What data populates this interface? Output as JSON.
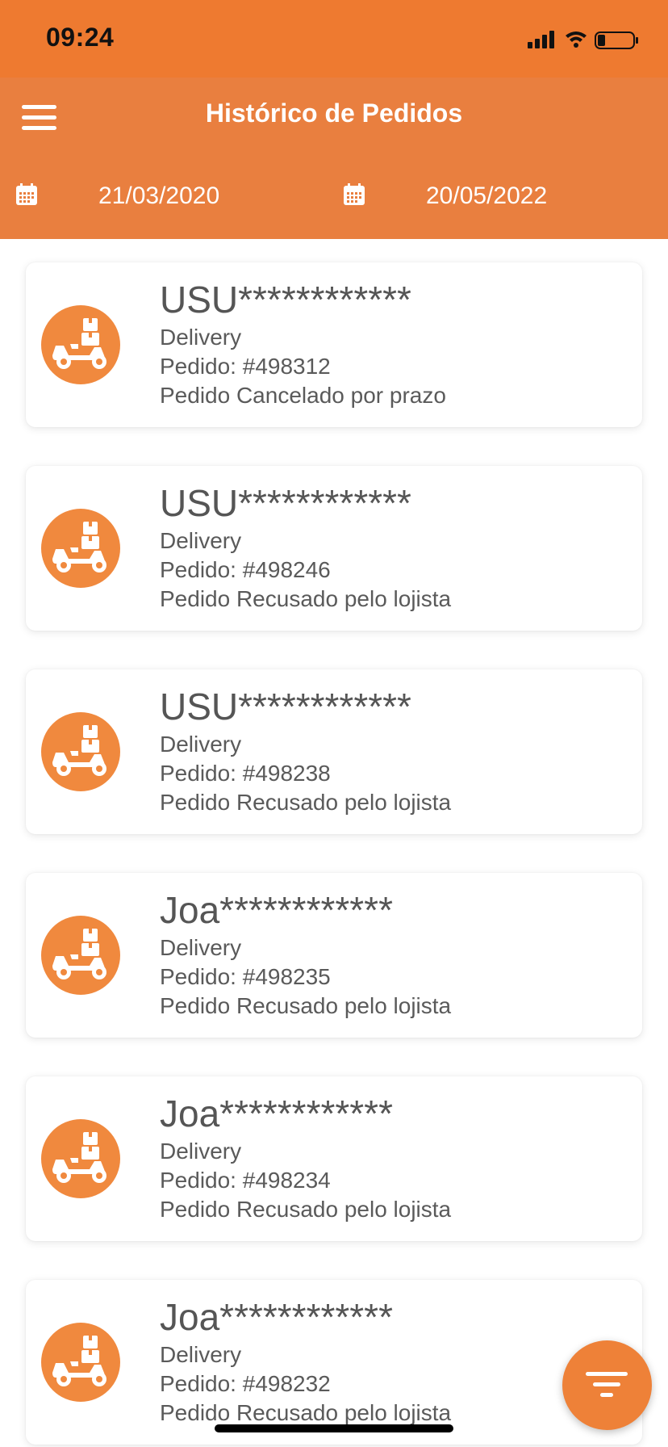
{
  "status_bar": {
    "time": "09:24"
  },
  "header": {
    "title": "Histórico de Pedidos",
    "date_from": "21/03/2020",
    "date_to": "20/05/2022"
  },
  "orders": [
    {
      "customer": "USU************",
      "type": "Delivery",
      "order": "Pedido: #498312",
      "status": "Pedido Cancelado por prazo"
    },
    {
      "customer": "USU************",
      "type": "Delivery",
      "order": "Pedido: #498246",
      "status": "Pedido Recusado pelo lojista"
    },
    {
      "customer": "USU************",
      "type": "Delivery",
      "order": "Pedido: #498238",
      "status": "Pedido Recusado pelo lojista"
    },
    {
      "customer": "Joa************",
      "type": "Delivery",
      "order": "Pedido: #498235",
      "status": "Pedido Recusado pelo lojista"
    },
    {
      "customer": "Joa************",
      "type": "Delivery",
      "order": "Pedido: #498234",
      "status": "Pedido Recusado pelo lojista"
    },
    {
      "customer": "Joa************",
      "type": "Delivery",
      "order": "Pedido: #498232",
      "status": "Pedido Recusado pelo lojista"
    }
  ],
  "icons": {
    "menu": "hamburger-menu-icon",
    "calendar": "calendar-icon",
    "order_type": "delivery-scooter-icon",
    "filter": "filter-icon"
  },
  "colors": {
    "status_bar": "#EE7A30",
    "header": "#E97F3F",
    "accent": "#F0893E"
  }
}
